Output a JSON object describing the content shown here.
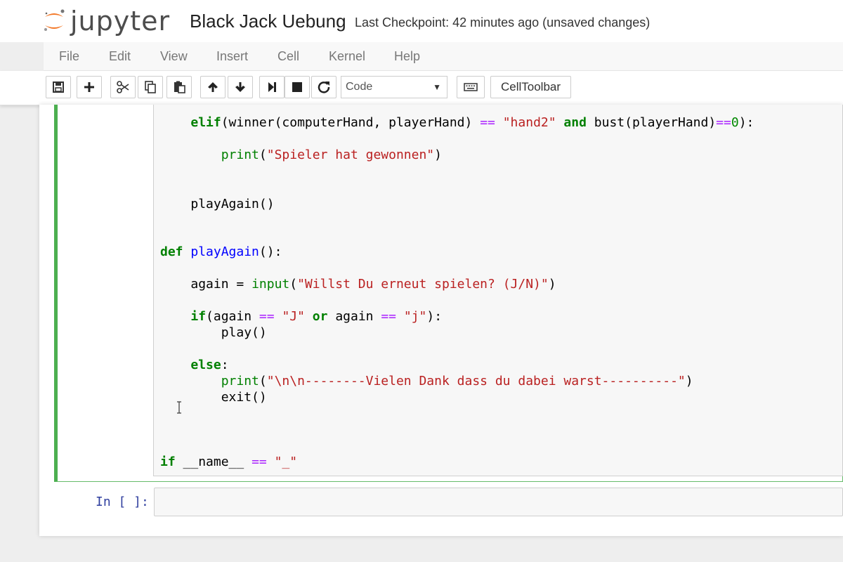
{
  "header": {
    "logo_text": "jupyter",
    "notebook_title": "Black Jack Uebung",
    "checkpoint": "Last Checkpoint: 42 minutes ago (unsaved changes)",
    "logo_color": "#f37726"
  },
  "menu": [
    "File",
    "Edit",
    "View",
    "Insert",
    "Cell",
    "Kernel",
    "Help"
  ],
  "toolbar": {
    "buttons": [
      "save-icon",
      "plus-icon",
      "scissors-icon",
      "copy-icon",
      "paste-icon",
      "arrow-up-icon",
      "arrow-down-icon",
      "run-step-icon",
      "stop-icon",
      "restart-icon",
      "keyboard-icon"
    ],
    "cell_type": "Code",
    "celltoolbar_label": "CellToolbar"
  },
  "code": {
    "indent4": "    ",
    "indent8": "        ",
    "elif_kw": "elif",
    "elif_call": "(winner(computerHand, playerHand) ",
    "eq": "==",
    "hand2": "\"hand2\"",
    "and_kw": "and",
    "bust_call": " bust(playerHand)",
    "zero": "0",
    "close_colon": "):",
    "print_kw": "print",
    "spieler_str": "\"Spieler hat gewonnen\"",
    "playagain_call": "playAgain()",
    "def_kw": "def",
    "def_name": "playAgain",
    "def_sig": "():",
    "again_assign": "again = ",
    "input_kw": "input",
    "input_str": "\"Willst Du erneut spielen? (J/N)\"",
    "if_kw": "if",
    "again_open": "(again ",
    "j_upper": "\"J\"",
    "or_kw": "or",
    "again_mid": " again ",
    "j_lower": "\"j\"",
    "play_call": "play()",
    "else_kw": "else",
    "colon": ":",
    "print_str": "\"\\n\\n--------Vielen Dank dass du dabei warst----------\"",
    "exit_call": "exit()",
    "name_var": " __name__ ",
    "name_str": "\"_\""
  },
  "empty_cell": {
    "prompt": "In [ ]:"
  }
}
